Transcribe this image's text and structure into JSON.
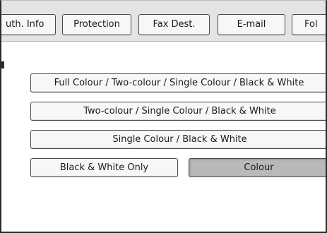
{
  "tabs": [
    {
      "label": "uth. Info"
    },
    {
      "label": "Protection"
    },
    {
      "label": "Fax Dest."
    },
    {
      "label": "E-mail"
    },
    {
      "label": "Fol"
    }
  ],
  "colour_options": {
    "full": "Full Colour / Two-colour / Single Colour / Black & White",
    "two": "Two-colour / Single Colour / Black & White",
    "single": "Single Colour / Black & White",
    "bw_only": "Black & White Only",
    "colour": "Colour",
    "selected": "Colour"
  }
}
